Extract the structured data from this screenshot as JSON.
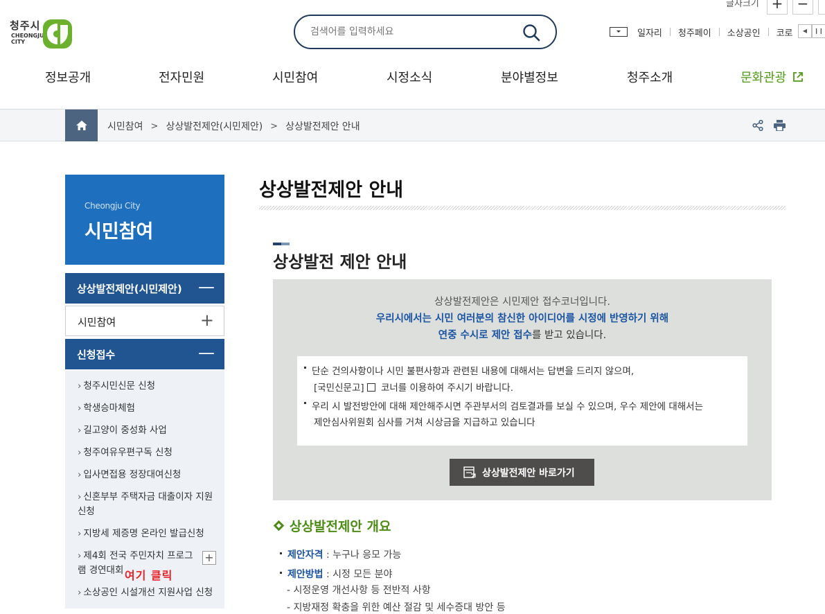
{
  "header": {
    "font_size_label": "글자크기",
    "font_plus": "+",
    "font_minus": "−",
    "logo": {
      "name": "청주시",
      "sub": "CHEONGJU CITY",
      "brand_color": "#6bb12e"
    },
    "search": {
      "placeholder": "검색어를 입력하세요"
    },
    "util_links": [
      "일자리",
      "청주페이",
      "소상공인",
      "코로"
    ]
  },
  "gnb": [
    "정보공개",
    "전자민원",
    "시민참여",
    "시정소식",
    "분야별정보",
    "청주소개",
    "문화관광"
  ],
  "breadcrumb": [
    "시민참여",
    "상상발전제안(시민제안)",
    "상상발전제안 안내"
  ],
  "sidebar": {
    "en_title": "Cheongju City",
    "title": "시민참여",
    "menus": [
      {
        "label": "상상발전제안(시민제안)",
        "toggle": "—"
      },
      {
        "label": "시민참여",
        "toggle": "+"
      },
      {
        "label": "신청접수",
        "toggle": "—"
      }
    ],
    "sub_items": [
      "청주시민신문 신청",
      "학생승마체험",
      "길고양이 중성화 사업",
      "청주여유우편구독 신청",
      "입사면접용 정장대여신청",
      "신혼부부 주택자금 대출이자 지원 신청",
      "지방세 제증명 온라인 발급신청",
      "제4회 전국 주민자치 프로그램 경연대회",
      "소상공인 시설개선 지원사업 신청"
    ],
    "red_note": "여기 클릭"
  },
  "content": {
    "page_title": "상상발전제안 안내",
    "section_title": "상상발전 제안 안내",
    "info": {
      "line1": "상상발전제안은 시민제안 접수코너입니다.",
      "line2": "우리시에서는 시민 여러분의 참신한 아이디어를 시정에 반영하기 위해",
      "line3_blue": "연중 수시로 제안 접수",
      "line3_rest": "를 받고 있습니다."
    },
    "notice": {
      "item1_a": "단순 건의사항이나 시민 불편사항과 관련된 내용에 대해서는 답변을 드리지 않으며,",
      "item1_b": "[국민신문고]",
      "item1_c": "코너를 이용하여 주시기 바랍니다.",
      "item2_a": "우리 시 발전방안에 대해 제안해주시면 주관부서의 검토결과를 보실 수 있으며, 우수 제안에 대해서는",
      "item2_b": "제안심사위원회 심사를 거쳐 시상금을 지급하고 있습니다"
    },
    "go_button": "상상발전제안 바로가기",
    "overview_title": "상상발전제안 개요",
    "overview": [
      {
        "key": "제안자격",
        "value": " : 누구나 응모 가능"
      },
      {
        "key": "제안방법",
        "value": " : 시정 모든 분야"
      }
    ],
    "overview_sub": [
      "시정운영 개선사항 등 전반적 사항",
      "지방재정 확충을 위한 예산 절감 및 세수증대 방안 등"
    ]
  }
}
